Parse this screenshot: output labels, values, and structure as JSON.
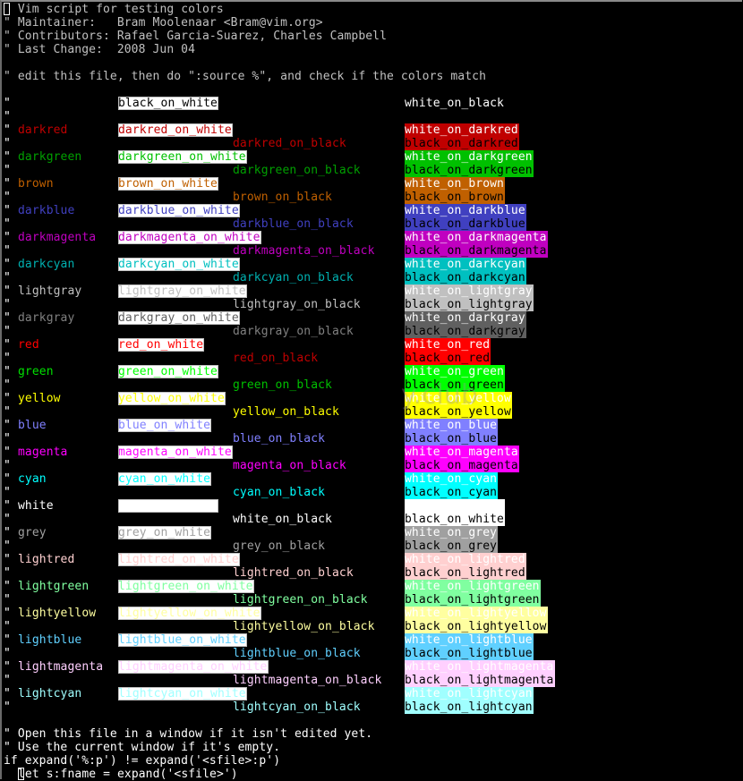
{
  "window": {
    "app": "Vim",
    "default_fg": "#c0c0c0",
    "default_bg": "#000000"
  },
  "header_lines": [
    "\" Vim script for testing colors",
    "\" Maintainer:   Bram Moolenaar <Bram@vim.org>",
    "\" Contributors: Rafael Garcia-Suarez, Charles Campbell",
    "\" Last Change:  2008 Jun 04",
    "",
    "\" edit this file, then do \":source %\", and check if the colors match",
    ""
  ],
  "baseline_row": {
    "black_on_white": "black_on_white",
    "white_on_black": "white_on_black"
  },
  "colors": [
    {
      "name": "darkred",
      "hex": "#c00000",
      "label_color": "#c00000"
    },
    {
      "name": "darkgreen",
      "hex": "#00c000",
      "label_color": "#00a000"
    },
    {
      "name": "brown",
      "hex": "#c06000",
      "label_color": "#c06000"
    },
    {
      "name": "darkblue",
      "hex": "#4040c0",
      "label_color": "#4040c0"
    },
    {
      "name": "darkmagenta",
      "hex": "#c000c0",
      "label_color": "#c000c0"
    },
    {
      "name": "darkcyan",
      "hex": "#00c0c0",
      "label_color": "#00b0b0"
    },
    {
      "name": "lightgray",
      "hex": "#c0c0c0",
      "label_color": "#c0c0c0"
    },
    {
      "name": "darkgray",
      "hex": "#606060",
      "label_color": "#808080"
    },
    {
      "name": "red",
      "hex": "#ff0000",
      "label_color": "#ff0000",
      "on_black_color": "#c00000"
    },
    {
      "name": "green",
      "hex": "#00ff00",
      "label_color": "#00e000",
      "on_black_color": "#00c000"
    },
    {
      "name": "yellow",
      "hex": "#ffff00",
      "label_color": "#ffff00"
    },
    {
      "name": "blue",
      "hex": "#8080ff",
      "label_color": "#8080ff"
    },
    {
      "name": "magenta",
      "hex": "#ff00ff",
      "label_color": "#ff00ff"
    },
    {
      "name": "cyan",
      "hex": "#00ffff",
      "label_color": "#00ffff"
    },
    {
      "name": "white",
      "hex": "#ffffff",
      "label_color": "#ffffff"
    },
    {
      "name": "grey",
      "hex": "#a0a0a0",
      "label_color": "#a0a0a0"
    },
    {
      "name": "lightred",
      "hex": "#ffd0d0",
      "label_color": "#ffd0d0"
    },
    {
      "name": "lightgreen",
      "hex": "#80ffa0",
      "label_color": "#80ffa0"
    },
    {
      "name": "lightyellow",
      "hex": "#ffffa0",
      "label_color": "#ffffa0"
    },
    {
      "name": "lightblue",
      "hex": "#60d0ff",
      "label_color": "#60d0ff"
    },
    {
      "name": "lightmagenta",
      "hex": "#ffd0ff",
      "label_color": "#ffd0ff"
    },
    {
      "name": "lightcyan",
      "hex": "#a0ffff",
      "label_color": "#a0ffff"
    }
  ],
  "footer_lines": [
    "",
    "\" Open this file in a window if it isn't edited yet.",
    "\" Use the current window if it's empty.",
    "if expand('%:p') != expand('<sfile>:p')",
    "  let s:fname = expand('<sfile>')"
  ],
  "watermark": "y.club"
}
